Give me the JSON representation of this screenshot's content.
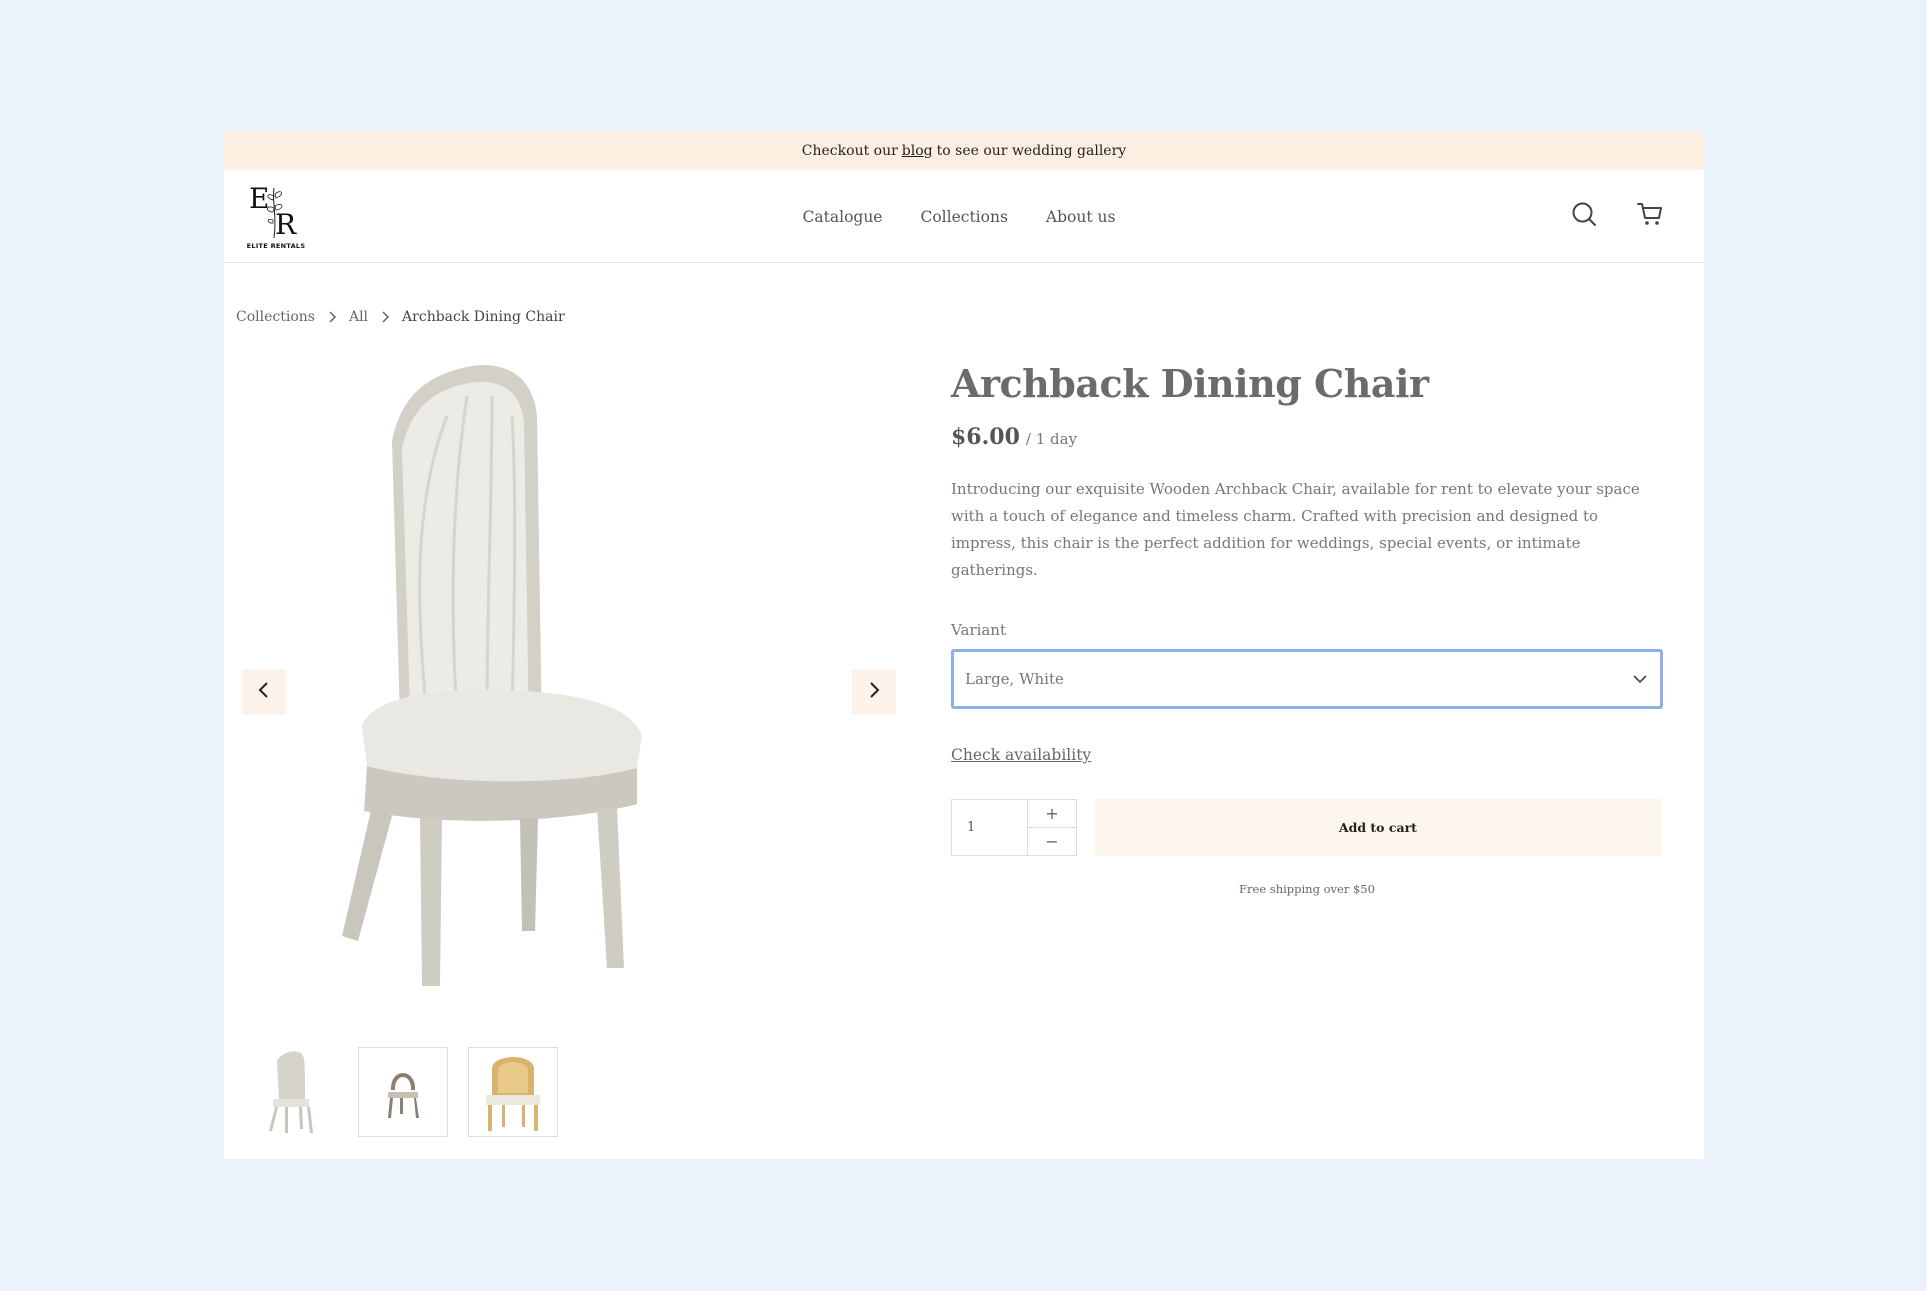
{
  "announcement": {
    "before": "Checkout our",
    "link": "blog",
    "after": "to see our wedding gallery"
  },
  "brand": {
    "monogram_left": "E",
    "monogram_right": "R",
    "name": "ELITE RENTALS"
  },
  "nav": {
    "items": [
      "Catalogue",
      "Collections",
      "About us"
    ]
  },
  "header_icons": [
    "search-icon",
    "cart-icon"
  ],
  "breadcrumb": {
    "items": [
      "Collections",
      "All",
      "Archback Dining Chair"
    ]
  },
  "gallery": {
    "thumbnails": [
      "white chair",
      "brown chair",
      "rattan chair"
    ],
    "active_index": 0
  },
  "product": {
    "title": "Archback Dining Chair",
    "price": "$6.00",
    "per": "/ 1 day",
    "description": "Introducing our exquisite Wooden Archback Chair, available for rent to elevate your space with a touch of elegance and timeless charm. Crafted with precision and designed to impress, this chair is the perfect addition for weddings, special events, or intimate gatherings.",
    "variant_label": "Variant",
    "variant_value": "Large, White",
    "check_availability": "Check availability",
    "quantity": "1",
    "add_to_cart": "Add to cart",
    "shipping_note": "Free shipping over $50"
  },
  "colors": {
    "page_bg": "#ecf2fc",
    "announcement_bg": "#fdeee2",
    "button_bg": "#fdf6ef",
    "focus_border": "#8eb0e8"
  }
}
